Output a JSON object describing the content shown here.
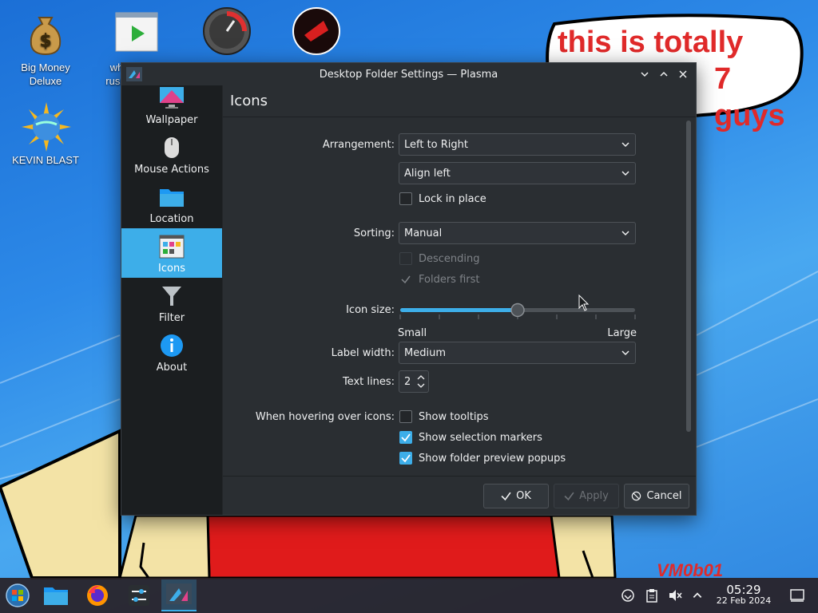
{
  "desktop": {
    "icons": [
      {
        "label": "Big Money Deluxe",
        "icon": "money-bag-icon"
      },
      {
        "label": "wh russi",
        "icon": "video-player-icon"
      },
      {
        "label": "",
        "icon": "speedometer-icon"
      },
      {
        "label": "",
        "icon": "red-game-icon"
      },
      {
        "label": "KEVIN BLAST",
        "icon": "globe-sun-icon"
      }
    ],
    "bubble_line1": "this is totally",
    "bubble_line2": "7 guys",
    "vm_text": "VM0b01"
  },
  "window": {
    "title": "Desktop Folder Settings — Plasma",
    "controls": {
      "minimize": "⌄",
      "maximize": "⌃",
      "close": "✕"
    }
  },
  "sidebar": {
    "items": [
      {
        "label": "Wallpaper",
        "icon": "wallpaper-icon"
      },
      {
        "label": "Mouse Actions",
        "icon": "mouse-icon"
      },
      {
        "label": "Location",
        "icon": "folder-icon"
      },
      {
        "label": "Icons",
        "icon": "icons-grid-icon",
        "active": true
      },
      {
        "label": "Filter",
        "icon": "funnel-icon"
      },
      {
        "label": "About",
        "icon": "info-icon"
      }
    ]
  },
  "page": {
    "title": "Icons",
    "arrangement_label": "Arrangement:",
    "arrangement_value": "Left to Right",
    "align_value": "Align left",
    "lock_label": "Lock in place",
    "lock_checked": false,
    "sorting_label": "Sorting:",
    "sorting_value": "Manual",
    "descending_label": "Descending",
    "folders_first_label": "Folders first",
    "icon_size_label": "Icon size:",
    "icon_size_fraction": 0.5,
    "icon_size_min": "Small",
    "icon_size_max": "Large",
    "label_width_label": "Label width:",
    "label_width_value": "Medium",
    "text_lines_label": "Text lines:",
    "text_lines_value": "2",
    "hover_label": "When hovering over icons:",
    "show_tooltips": "Show tooltips",
    "show_tooltips_checked": false,
    "show_selection_markers": "Show selection markers",
    "show_selection_markers_checked": true,
    "show_folder_preview": "Show folder preview popups",
    "show_folder_preview_checked": true
  },
  "buttons": {
    "ok": "OK",
    "apply": "Apply",
    "cancel": "Cancel"
  },
  "taskbar": {
    "apps": [
      "start-menu-icon",
      "file-manager-icon",
      "firefox-icon",
      "system-settings-icon",
      "plasma-settings-icon"
    ],
    "time": "05:29",
    "date": "22 Feb 2024"
  },
  "colors": {
    "accent": "#3daee9",
    "bubble_text": "#e02a2a",
    "window_bg": "#232629"
  }
}
